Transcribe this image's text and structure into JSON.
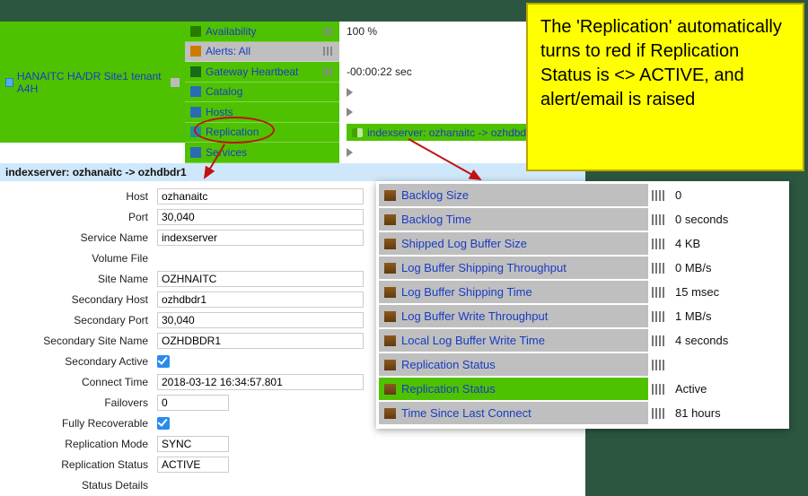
{
  "root": {
    "label": "HANAITC HA/DR Site1 tenant A4H"
  },
  "nav": {
    "availability": "Availability",
    "alerts": "Alerts: All",
    "gateway": "Gateway Heartbeat",
    "catalog": "Catalog",
    "hosts": "Hosts",
    "replication": "Replication",
    "services": "Services"
  },
  "nav_values": {
    "availability": "100 %",
    "gateway": "-00:00:22 sec",
    "replication_tag": "indexserver: ozhanaitc -> ozhdbdr1"
  },
  "detail_header": "indexserver: ozhanaitc -> ozhdbdr1",
  "details": {
    "labels": {
      "host": "Host",
      "port": "Port",
      "service_name": "Service Name",
      "volume_file": "Volume File",
      "site_name": "Site Name",
      "secondary_host": "Secondary Host",
      "secondary_port": "Secondary Port",
      "secondary_site_name": "Secondary Site Name",
      "secondary_active": "Secondary Active",
      "connect_time": "Connect Time",
      "failovers": "Failovers",
      "fully_recoverable": "Fully Recoverable",
      "replication_mode": "Replication Mode",
      "replication_status": "Replication Status",
      "status_details": "Status Details"
    },
    "values": {
      "host": "ozhanaitc",
      "port": "30,040",
      "service_name": "indexserver",
      "volume_file": "",
      "site_name": "OZHNAITC",
      "secondary_host": "ozhdbdr1",
      "secondary_port": "30,040",
      "secondary_site_name": "OZHDBDR1",
      "connect_time": "2018-03-12 16:34:57.801",
      "failovers": "0",
      "replication_mode": "SYNC",
      "replication_status": "ACTIVE"
    }
  },
  "metrics": [
    {
      "label": "Backlog Size",
      "value": "0",
      "bg": "mg-bg"
    },
    {
      "label": "Backlog Time",
      "value": "0 seconds",
      "bg": "mg-bg"
    },
    {
      "label": "Shipped Log Buffer Size",
      "value": "4 KB",
      "bg": "mg-bg"
    },
    {
      "label": "Log Buffer Shipping Throughput",
      "value": "0 MB/s",
      "bg": "mg-bg"
    },
    {
      "label": "Log Buffer Shipping Time",
      "value": "15 msec",
      "bg": "mg-bg"
    },
    {
      "label": "Log Buffer Write Throughput",
      "value": "1 MB/s",
      "bg": "mg-bg"
    },
    {
      "label": "Local Log Buffer Write Time",
      "value": "4 seconds",
      "bg": "mg-bg"
    },
    {
      "label": "Replication Status",
      "value": "",
      "bg": "mg-bg"
    },
    {
      "label": "Replication Status",
      "value": "Active",
      "bg": "mg-gr"
    },
    {
      "label": "Time Since Last Connect",
      "value": "81 hours",
      "bg": "mg-bg"
    }
  ],
  "callout": "The 'Replication' automatically turns to red if Replication Status is <> ACTIVE, and alert/email is raised"
}
